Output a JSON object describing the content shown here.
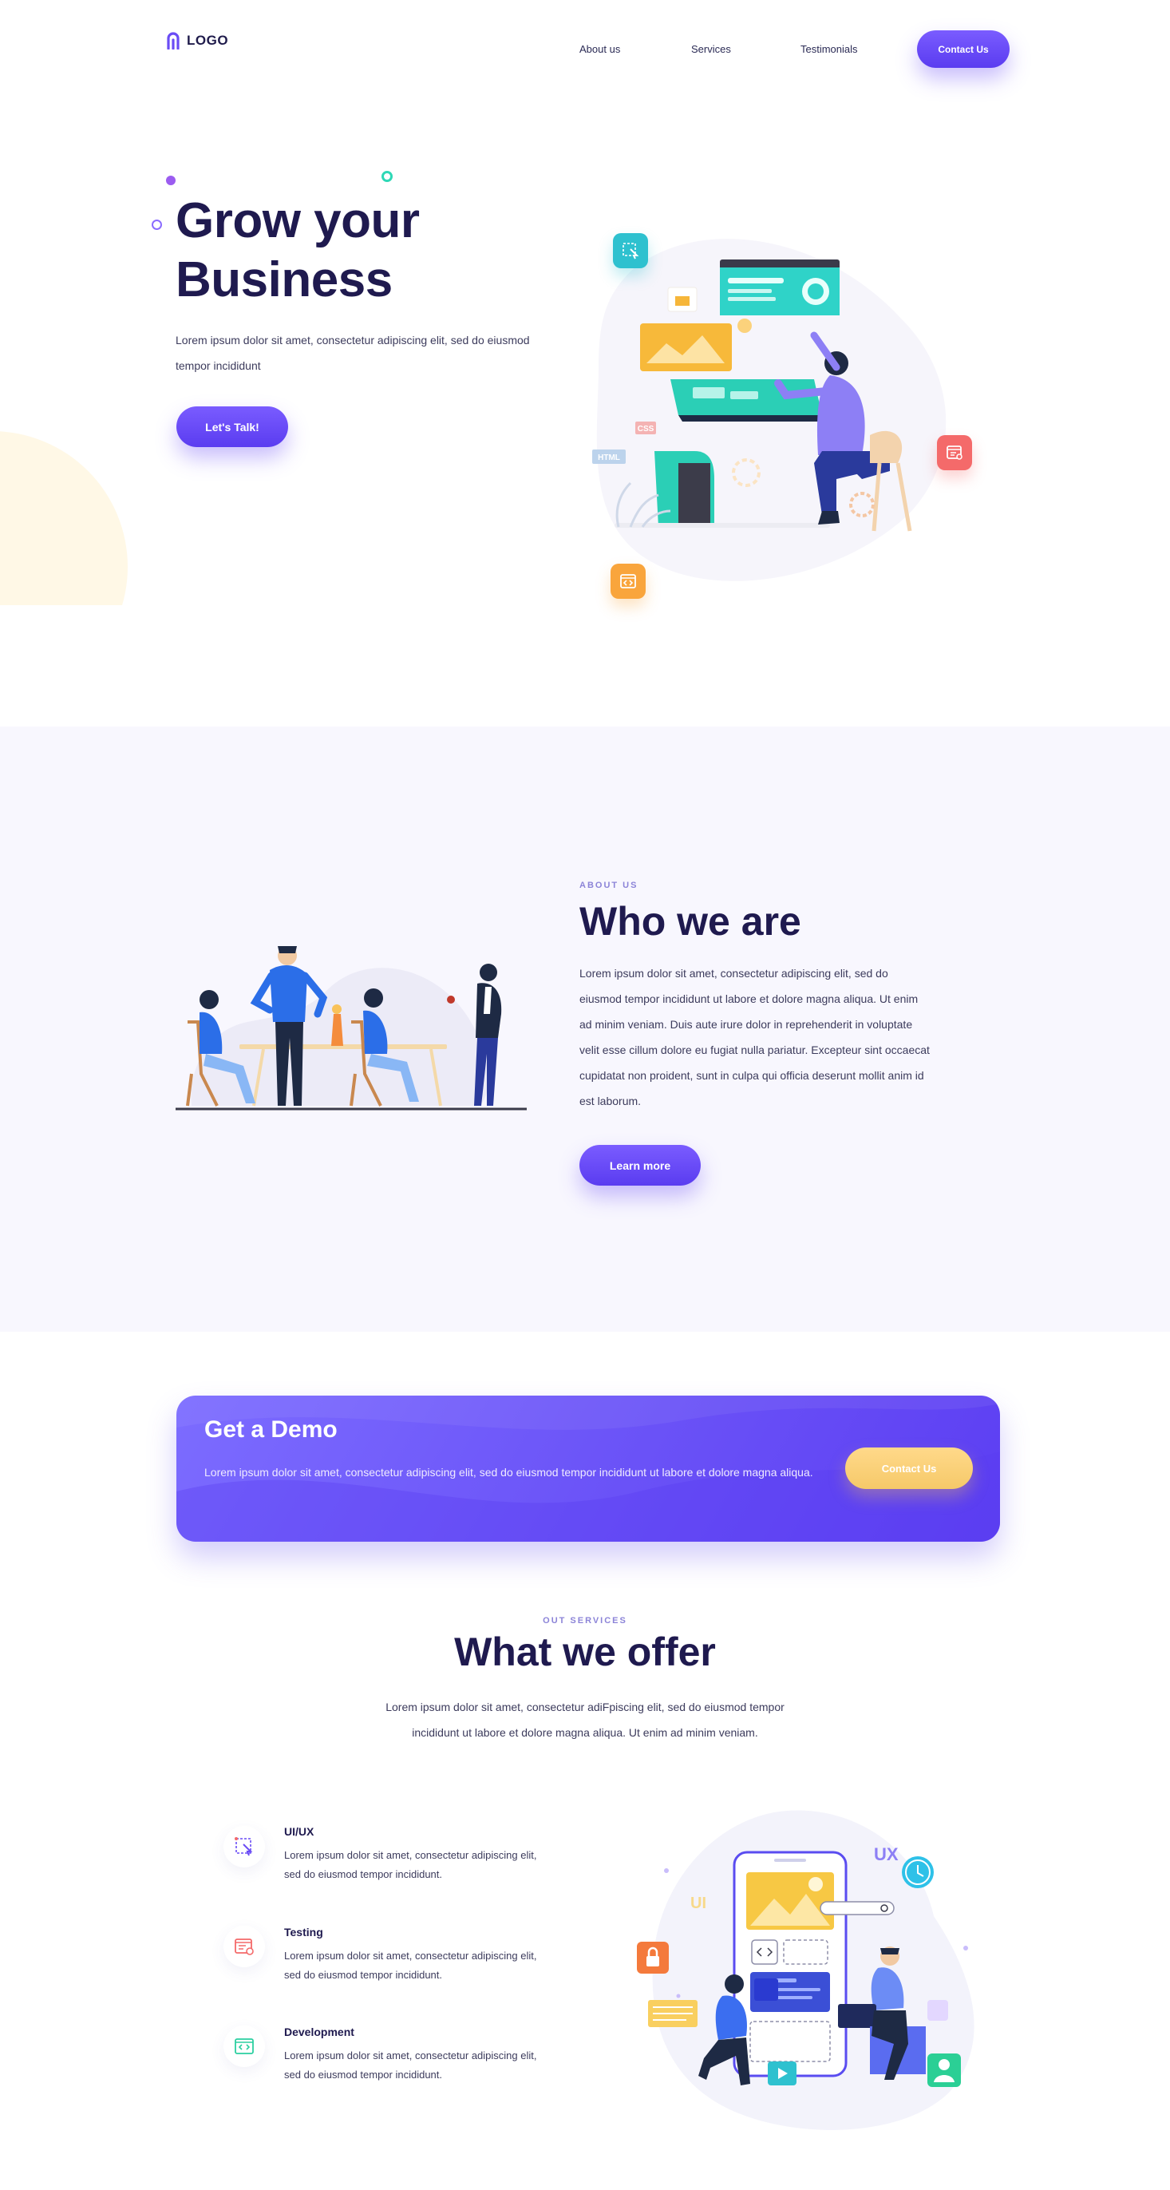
{
  "header": {
    "logo": "LOGO",
    "nav": [
      "About us",
      "Services",
      "Testimonials"
    ],
    "contact_label": "Contact Us"
  },
  "hero": {
    "title_line1": "Grow your",
    "title_line2": "Business",
    "text": "Lorem ipsum dolor sit amet, consectetur adipiscing elit, sed do eiusmod tempor incididunt",
    "button": "Let's Talk!",
    "illustration_labels": {
      "css": "CSS",
      "html": "HTML"
    }
  },
  "about": {
    "eyebrow": "ABOUT US",
    "title": "Who we are",
    "text": "Lorem ipsum dolor sit amet, consectetur adipiscing elit, sed do eiusmod tempor incididunt ut labore et dolore magna aliqua. Ut enim ad minim veniam. Duis aute irure dolor in reprehenderit in voluptate velit esse cillum dolore eu fugiat nulla pariatur. Excepteur sint occaecat cupidatat non proident, sunt in culpa qui officia deserunt mollit anim id est laborum.",
    "button": "Learn more"
  },
  "demo": {
    "title": "Get a Demo",
    "text": "Lorem ipsum dolor sit amet, consectetur adipiscing elit, sed do eiusmod tempor incididunt ut labore et dolore magna aliqua.",
    "button": "Contact Us"
  },
  "services": {
    "eyebrow": "OUT SERVICES",
    "title": "What we offer",
    "text": "Lorem ipsum dolor sit amet, consectetur adiFpiscing elit, sed do eiusmod tempor incididunt ut labore et dolore magna aliqua. Ut enim ad minim veniam.",
    "items": [
      {
        "title": "UI/UX",
        "text": "Lorem ipsum dolor sit amet, consectetur adipiscing elit, sed do eiusmod tempor incididunt.",
        "icon": "design-cursor-icon"
      },
      {
        "title": "Testing",
        "text": "Lorem ipsum dolor sit amet, consectetur adipiscing elit, sed do eiusmod tempor incididunt.",
        "icon": "testing-icon"
      },
      {
        "title": "Development",
        "text": "Lorem ipsum dolor sit amet, consectetur adipiscing elit, sed do eiusmod tempor incididunt.",
        "icon": "code-icon"
      }
    ],
    "illustration_labels": {
      "ux": "UX",
      "ui": "UI"
    }
  },
  "colors": {
    "primary": "#6a4cf5",
    "heading": "#1f1a4f",
    "accent_yellow": "#f6c969",
    "section_band": "#f8f7fe"
  }
}
